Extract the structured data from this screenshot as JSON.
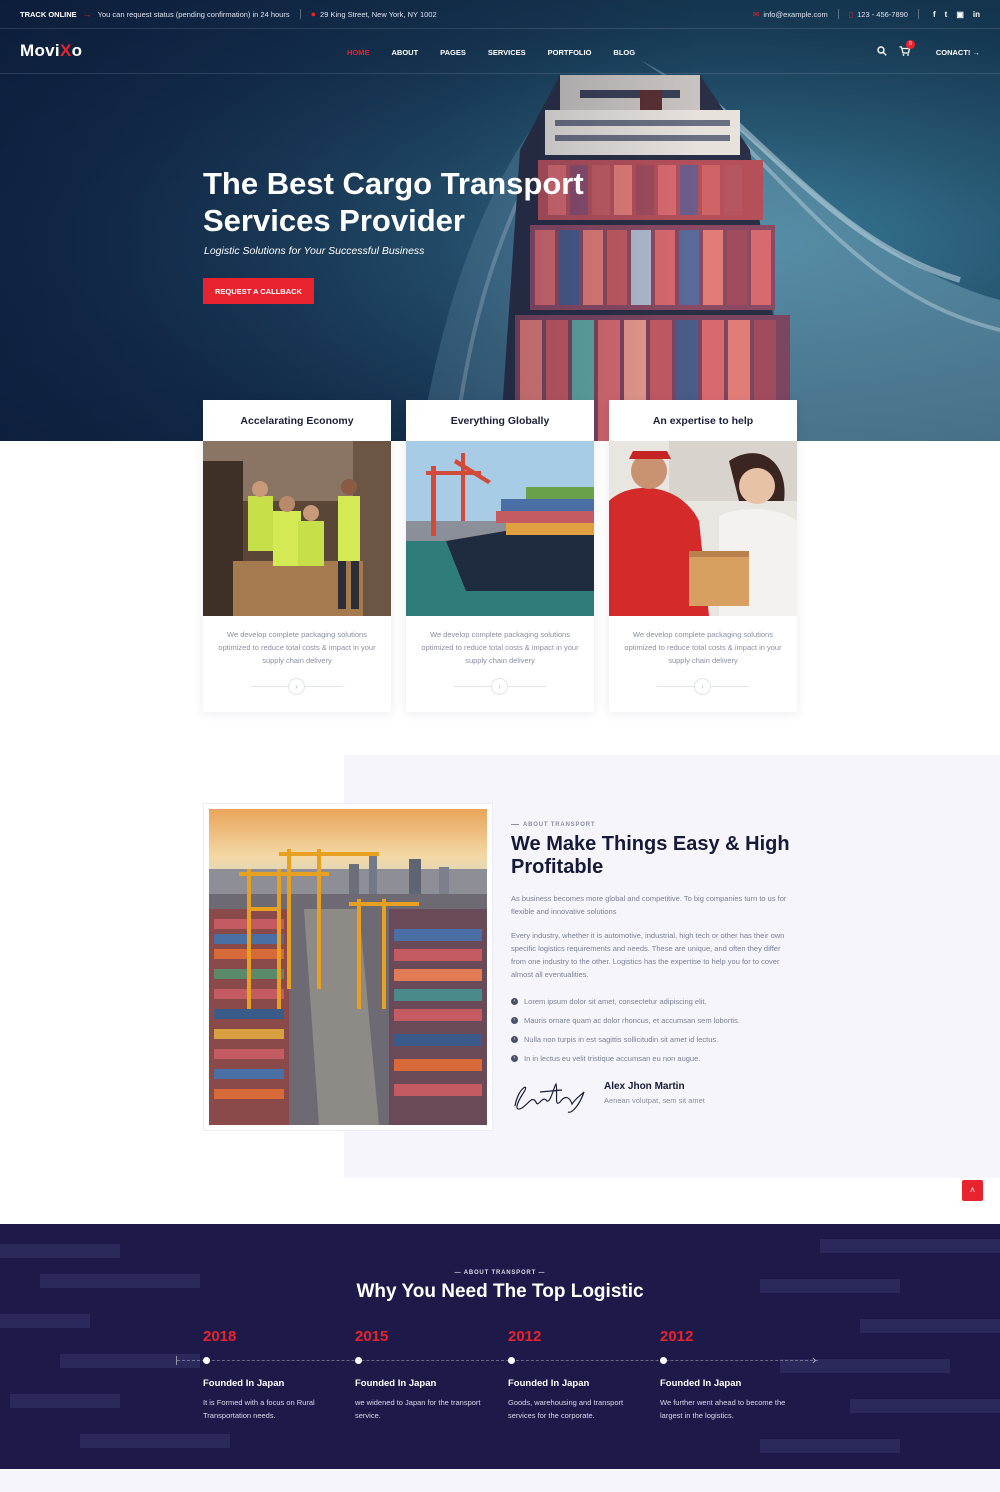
{
  "topbar": {
    "track_label": "TRACK ONLINE",
    "track_message": "You can request status (pending confirmation) in 24 hours",
    "address": "29 King Street, New York, NY 1002",
    "email": "info@example.com",
    "phone": "123 - 456-7890",
    "social": [
      "f",
      "t",
      "▣",
      "in"
    ]
  },
  "nav": {
    "logo_main": "Movi",
    "logo_x": "X",
    "logo_end": "o",
    "items": [
      "HOME",
      "ABOUT",
      "PAGES",
      "SERVICES",
      "PORTFOLIO",
      "BLOG"
    ],
    "active": "HOME",
    "cart_count": "0",
    "contact_label": "CONACT!"
  },
  "hero": {
    "title": "The Best Cargo Transport Services Provider",
    "subtitle": "Logistic Solutions for Your Successful Business",
    "cta_label": "REQUEST A CALLBACK"
  },
  "cards": [
    {
      "title": "Accelarating Economy",
      "text": "We develop complete packaging solutions optimized to reduce total costs & impact in your supply chain delivery"
    },
    {
      "title": "Everything Globally",
      "text": "We develop complete packaging solutions optimized to reduce total costs & impact in your supply chain delivery"
    },
    {
      "title": "An expertise to help",
      "text": "We develop complete packaging solutions optimized to reduce total costs & impact in your supply chain delivery"
    }
  ],
  "about": {
    "tag": "ABOUT TRANSPORT",
    "title": "We Make Things Easy & High Profitable",
    "para1": "As business becomes more global and competitive. To big companies turn to us for flexible and innovative solutions",
    "para2": "Every industry, whether it is automotive, industrial, high tech or other has their own specific logistics requirements and needs. These are unique, and often they differ from one industry to the other. Logistics has the expertise to help you for to cover almost all eventualities.",
    "checks": [
      "Lorem ipsum dolor sit amet, consectetur adipiscing elit.",
      "Mauris ornare quam ac dolor rhoncus, et accumsan sem lobortis.",
      "Nulla non turpis in est sagittis sollicitudin sit amet id lectus.",
      "In in lectus eu velit tristique accumsan eu non augue."
    ],
    "author_name": "Alex Jhon Martin",
    "author_role": "Aenean volutpat, sem sit amet"
  },
  "why": {
    "tag": "ABOUT TRANSPORT",
    "title": "Why You Need The Top Logistic",
    "timeline": [
      {
        "year": "2018",
        "heading": "Founded In Japan",
        "text": "It is Formed with a focus on Rural Transportation needs."
      },
      {
        "year": "2015",
        "heading": "Founded In Japan",
        "text": "we widened to Japan for the transport service."
      },
      {
        "year": "2012",
        "heading": "Founded In Japan",
        "text": "Goods, warehousing and transport services for the corporate."
      },
      {
        "year": "2012",
        "heading": "Founded In Japan",
        "text": "We further went ahead to become the largest in the logistics."
      }
    ]
  },
  "colors": {
    "accent": "#e8232d",
    "navy": "#1d1a4a",
    "text_dark": "#161a3a",
    "text_muted": "#7a8099"
  }
}
